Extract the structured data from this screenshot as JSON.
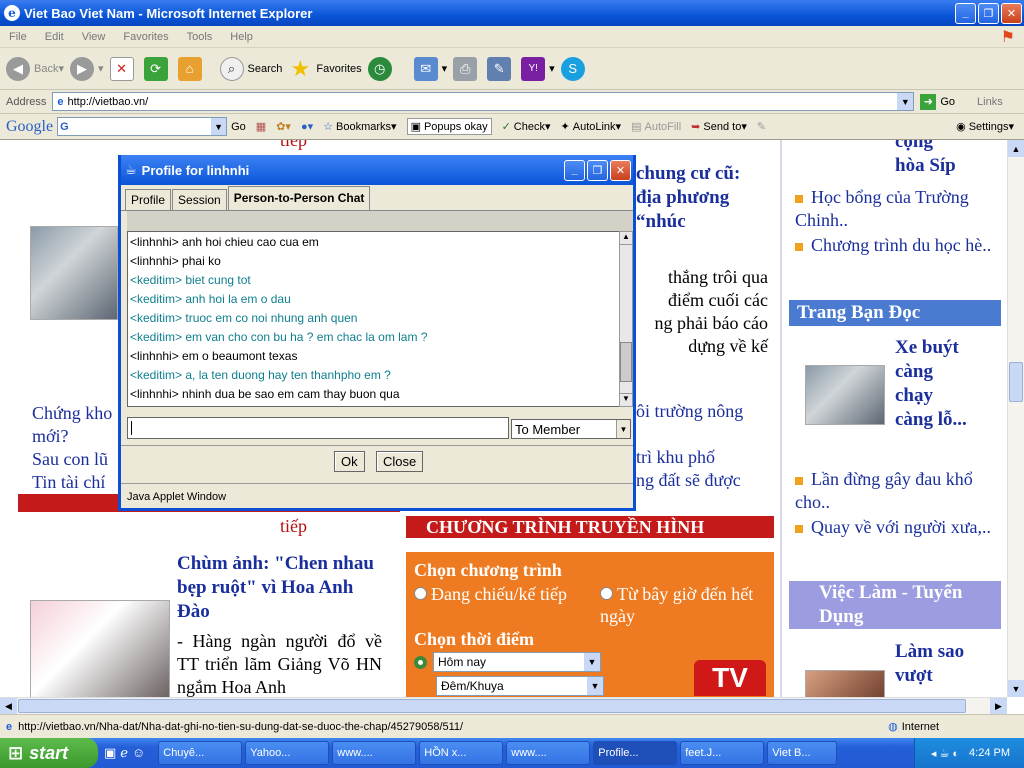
{
  "ie": {
    "title": "Viet Bao Viet Nam - Microsoft Internet Explorer",
    "menu": [
      "File",
      "Edit",
      "View",
      "Favorites",
      "Tools",
      "Help"
    ],
    "toolbar": {
      "back": "Back",
      "search": "Search",
      "favorites": "Favorites"
    },
    "address_label": "Address",
    "address_value": "http://vietbao.vn/",
    "go": "Go",
    "links": "Links"
  },
  "google_bar": {
    "logo": "Google",
    "search_value": "G",
    "go": "Go",
    "bookmarks": "Bookmarks",
    "popups": "Popups okay",
    "check": "Check",
    "autolink": "AutoLink",
    "autofill": "AutoFill",
    "send_to": "Send to",
    "settings": "Settings"
  },
  "page": {
    "tiep": "tiếp",
    "headline_right_1": "chung cư cũ:",
    "headline_right_2": "địa phương",
    "headline_right_3": "“nhúc",
    "para_right_1": "thắng trôi qua",
    "para_right_2": "điểm cuối các",
    "para_right_3": "ng phải báo cáo",
    "para_right_4": "dựng về kế",
    "link_right_1": "ôi trường nông",
    "link_right_2": "trì khu phố",
    "link_right_3": "ng đất sẽ được",
    "left_link_1": "Chứng kho",
    "left_link_2": "mới?",
    "left_link_3": "Sau con lũ",
    "left_link_4": "Tin tài chí",
    "news_title": "Chùm ảnh: \"Chen nhau bẹp ruột\" vì Hoa Anh Đào",
    "news_summary": "- Hàng ngàn người đổ về TT triển lãm Giảng Võ HN ngắm Hoa Anh",
    "tv_banner": "CHƯƠNG TRÌNH TRUYỀN HÌNH",
    "tv_choose": "Chọn chương trình",
    "tv_opt_1": "Đang chiếu/kế tiếp",
    "tv_opt_2": "Từ bây giờ đến hết ngày",
    "tv_time_label": "Chọn thời điểm",
    "tv_time_1": "Hôm nay",
    "tv_time_2": "Đêm/Khuya",
    "tv_logo": "TV",
    "sidebar_top_1": "cộng",
    "sidebar_top_2": "hòa Síp",
    "sidebar_link_1": "Học bổng của Trường Chinh..",
    "sidebar_link_2": "Chương trình du học hè..",
    "sidebar_head_1": "Trang Bạn Đọc",
    "sidebar_story_1": "Xe buýt càng chạy càng lỗ...",
    "sidebar_link_3": "Lần đừng gây đau khổ cho..",
    "sidebar_link_4": "Quay về với người xưa,..",
    "sidebar_head_2": "Việc Làm - Tuyển Dụng",
    "sidebar_story_2_1": "Làm sao",
    "sidebar_story_2_2": "vượt"
  },
  "applet": {
    "title": "Profile for linhnhi",
    "tabs": [
      "Profile",
      "Session",
      "Person-to-Person Chat"
    ],
    "messages": [
      {
        "who": "other",
        "text": "<linhnhi>  anh hoi chieu cao cua em"
      },
      {
        "who": "other",
        "text": "<linhnhi>  phai ko"
      },
      {
        "who": "me",
        "text": "<keditim> biet cung tot"
      },
      {
        "who": "me",
        "text": "<keditim> anh hoi la em o dau"
      },
      {
        "who": "me",
        "text": "<keditim> truoc em co noi nhung anh quen"
      },
      {
        "who": "me",
        "text": "<keditim> em van cho con bu ha ? em chac la om lam ?"
      },
      {
        "who": "other",
        "text": "<linhnhi>  em o beaumont texas"
      },
      {
        "who": "me",
        "text": "<keditim> a, la ten duong hay ten thanhpho em ?"
      },
      {
        "who": "other",
        "text": "<linhnhi>  nhinh dua be sao em cam thay buon qua"
      }
    ],
    "input_value": "",
    "recipient": "To Member",
    "ok": "Ok",
    "close": "Close",
    "footer": "Java Applet Window"
  },
  "status": {
    "url": "http://vietbao.vn/Nha-dat/Nha-dat-ghi-no-tien-su-dung-dat-se-duoc-the-chap/45279058/511/",
    "zone": "Internet"
  },
  "taskbar": {
    "start": "start",
    "tasks": [
      "Chuyê...",
      "Yahoo...",
      "www....",
      "HỒN x...",
      "www....",
      "Profile...",
      "feet.J...",
      "Viet B..."
    ],
    "active_task": 5,
    "clock": "4:24 PM"
  }
}
